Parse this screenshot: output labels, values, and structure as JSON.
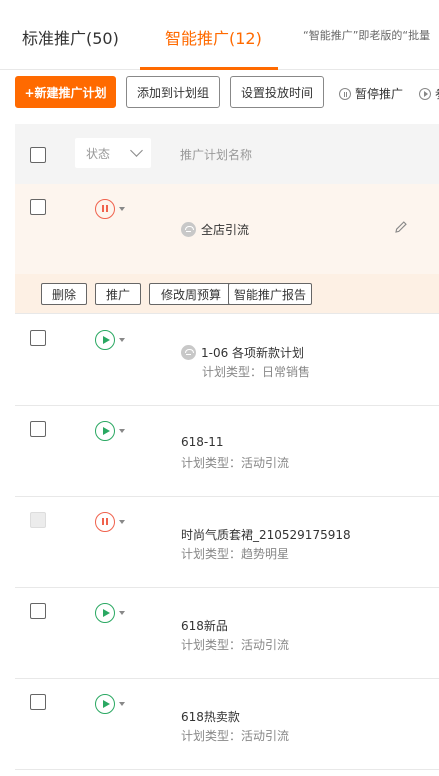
{
  "tabs": {
    "standard": "标准推广(50)",
    "smart": "智能推广(12)",
    "notice": "“智能推广”即老版的“批量"
  },
  "toolbar": {
    "new_plan": "+新建推广计划",
    "add_to_group": "添加到计划组",
    "set_time": "设置投放时间",
    "pause": "暂停推广",
    "more": "参"
  },
  "table": {
    "status_filter": "状态",
    "col_name": "推广计划名称"
  },
  "rows": [
    {
      "status": "paused",
      "name": "全店引流",
      "type": ""
    },
    {
      "status": "running",
      "name": "1-06 各项新款计划",
      "type": "计划类型：日常销售"
    },
    {
      "status": "running",
      "name": "618-11",
      "type": "计划类型：活动引流"
    },
    {
      "status": "paused",
      "name": "时尚气质套裙_210529175918",
      "type": "计划类型：趋势明星"
    },
    {
      "status": "running",
      "name": "618新品",
      "type": "计划类型：活动引流"
    },
    {
      "status": "running",
      "name": "618热卖款",
      "type": "计划类型：活动引流"
    }
  ],
  "actions": {
    "delete": "删除",
    "promote": "推广",
    "budget": "修改周预算",
    "report": "智能推广报告"
  },
  "colors": {
    "accent": "#ff6a00",
    "paused": "#f0624d",
    "running": "#2aa862"
  }
}
